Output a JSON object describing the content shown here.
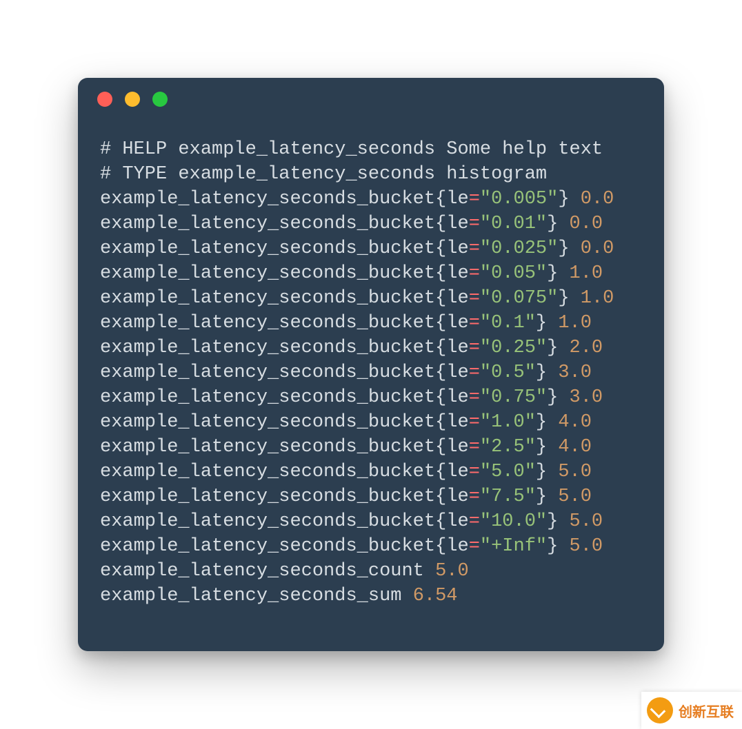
{
  "colors": {
    "window_bg": "#2c3e50",
    "text": "#d7dde2",
    "operator": "#ff6b6b",
    "string": "#98c379",
    "number": "#d19a66",
    "dot_red": "#ff5f57",
    "dot_yellow": "#febc2e",
    "dot_green": "#28c840",
    "watermark_accent": "#f39c12"
  },
  "watermark": {
    "label": "创新互联"
  },
  "code": {
    "comment_lines": [
      "# HELP example_latency_seconds Some help text",
      "# TYPE example_latency_seconds histogram"
    ],
    "bucket_metric": "example_latency_seconds_bucket",
    "bucket_label_key": "le",
    "buckets": [
      {
        "le": "0.005",
        "value": "0.0"
      },
      {
        "le": "0.01",
        "value": "0.0"
      },
      {
        "le": "0.025",
        "value": "0.0"
      },
      {
        "le": "0.05",
        "value": "1.0"
      },
      {
        "le": "0.075",
        "value": "1.0"
      },
      {
        "le": "0.1",
        "value": "1.0"
      },
      {
        "le": "0.25",
        "value": "2.0"
      },
      {
        "le": "0.5",
        "value": "3.0"
      },
      {
        "le": "0.75",
        "value": "3.0"
      },
      {
        "le": "1.0",
        "value": "4.0"
      },
      {
        "le": "2.5",
        "value": "4.0"
      },
      {
        "le": "5.0",
        "value": "5.0"
      },
      {
        "le": "7.5",
        "value": "5.0"
      },
      {
        "le": "10.0",
        "value": "5.0"
      },
      {
        "le": "+Inf",
        "value": "5.0"
      }
    ],
    "summary": [
      {
        "name": "example_latency_seconds_count",
        "value": "5.0"
      },
      {
        "name": "example_latency_seconds_sum",
        "value": "6.54"
      }
    ]
  }
}
